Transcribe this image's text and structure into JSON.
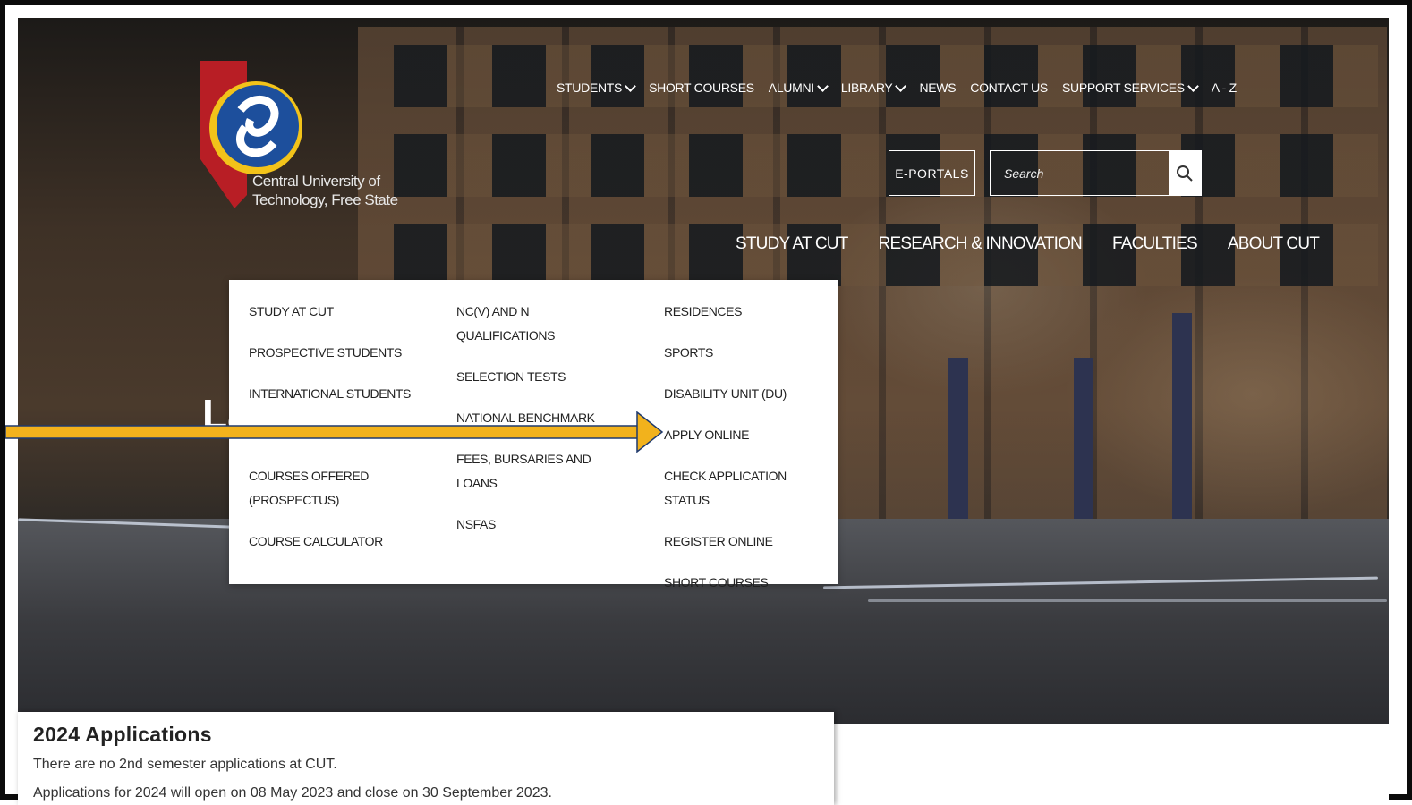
{
  "logo": {
    "line1": "Central University of",
    "line2": "Technology, Free State"
  },
  "top_nav": [
    {
      "label": "STUDENTS",
      "has_dropdown": true
    },
    {
      "label": "SHORT COURSES",
      "has_dropdown": false
    },
    {
      "label": "ALUMNI",
      "has_dropdown": true
    },
    {
      "label": "LIBRARY",
      "has_dropdown": true
    },
    {
      "label": "NEWS",
      "has_dropdown": false
    },
    {
      "label": "CONTACT US",
      "has_dropdown": false
    },
    {
      "label": "SUPPORT SERVICES",
      "has_dropdown": true
    },
    {
      "label": "A - Z",
      "has_dropdown": false
    }
  ],
  "eportals_label": "E-PORTALS",
  "search": {
    "placeholder": "Search",
    "icon": "search-icon"
  },
  "main_nav": [
    "STUDY AT CUT",
    "RESEARCH & INNOVATION",
    "FACULTIES",
    "ABOUT CUT"
  ],
  "dropdown": {
    "col1": [
      "STUDY AT CUT",
      "PROSPECTIVE STUDENTS",
      "INTERNATIONAL STUDENTS",
      "",
      "COURSES OFFERED (PROSPECTUS)",
      "COURSE CALCULATOR"
    ],
    "col2": [
      "NC(V) AND N QUALIFICATIONS",
      "SELECTION TESTS",
      "NATIONAL BENCHMARK TEST (NBT)",
      "FEES, BURSARIES AND LOANS",
      "NSFAS"
    ],
    "col3": [
      "RESIDENCES",
      "SPORTS",
      "DISABILITY UNIT (DU)",
      "APPLY ONLINE",
      "CHECK APPLICATION STATUS",
      "REGISTER ONLINE",
      "SHORT COURSES"
    ]
  },
  "hero_peek_text": "La",
  "annotation": {
    "type": "arrow",
    "color": "#f2b21c",
    "points_to": "APPLY ONLINE"
  },
  "notice": {
    "title": "2024 Applications",
    "line1": "There are no 2nd semester applications at CUT.",
    "line2": "Applications for 2024 will open on 08 May 2023 and close on 30 September 2023."
  },
  "colors": {
    "arrow": "#f2b21c",
    "arrow_outline": "#1f3a6e",
    "logo_red": "#b81e25",
    "logo_yellow": "#f2c31a",
    "logo_blue": "#1d4f9c"
  }
}
